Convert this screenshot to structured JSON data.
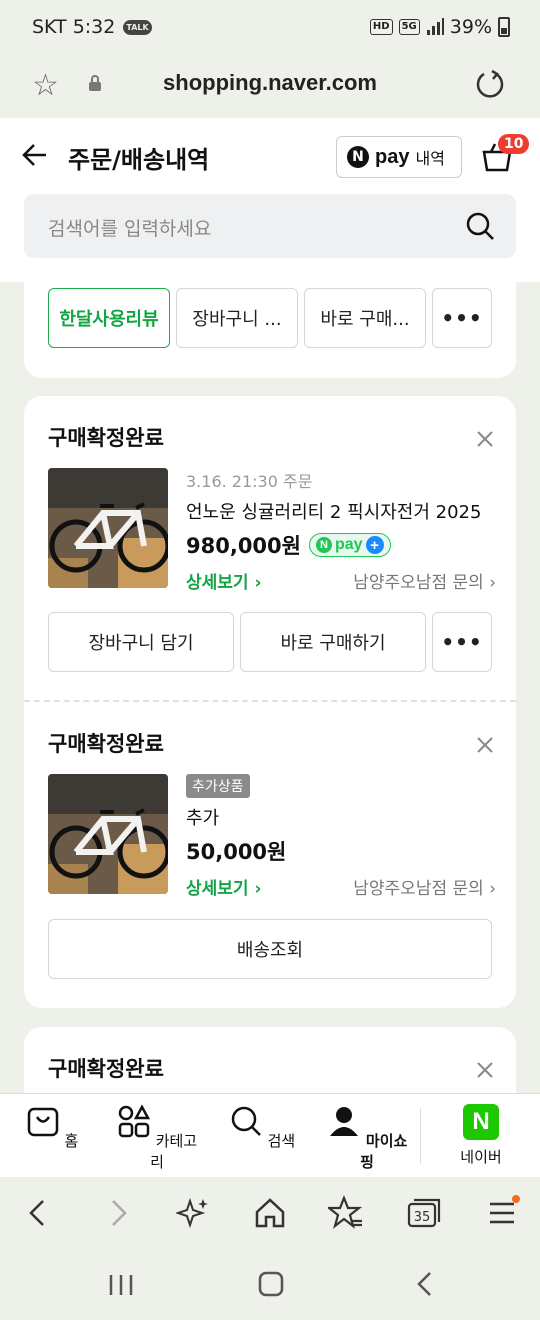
{
  "status": {
    "carrier_time": "SKT 5:32",
    "talk": "TALK",
    "battery": "39%"
  },
  "browser": {
    "url": "shopping.naver.com"
  },
  "header": {
    "title": "주문/배송내역",
    "npay_pay": "pay",
    "npay_label": "내역",
    "cart_count": "10"
  },
  "search": {
    "placeholder": "검색어를 입력하세요"
  },
  "top_actions": {
    "review": "한달사용리뷰",
    "cart": "장바구니 ...",
    "buy": "바로 구매...",
    "more": "•••"
  },
  "order1": {
    "status": "구매확정완료",
    "date": "3.16. 21:30 주문",
    "name": "언노운 싱귤러리티 2 픽시자전거 2025",
    "price": "980,000원",
    "npay": "pay",
    "detail": "상세보기 ›",
    "store": "남양주오남점 문의 ›",
    "btn_cart": "장바구니 담기",
    "btn_buy": "바로 구매하기",
    "btn_more": "•••"
  },
  "order2": {
    "status": "구매확정완료",
    "tag": "추가상품",
    "name": "추가",
    "price": "50,000원",
    "detail": "상세보기 ›",
    "store": "남양주오남점 문의 ›",
    "btn_track": "배송조회"
  },
  "order3": {
    "status": "구매확정완료"
  },
  "nav": {
    "home": "홈",
    "category": "카테고리",
    "search": "검색",
    "myshopping": "마이쇼핑",
    "naver": "네이버"
  }
}
